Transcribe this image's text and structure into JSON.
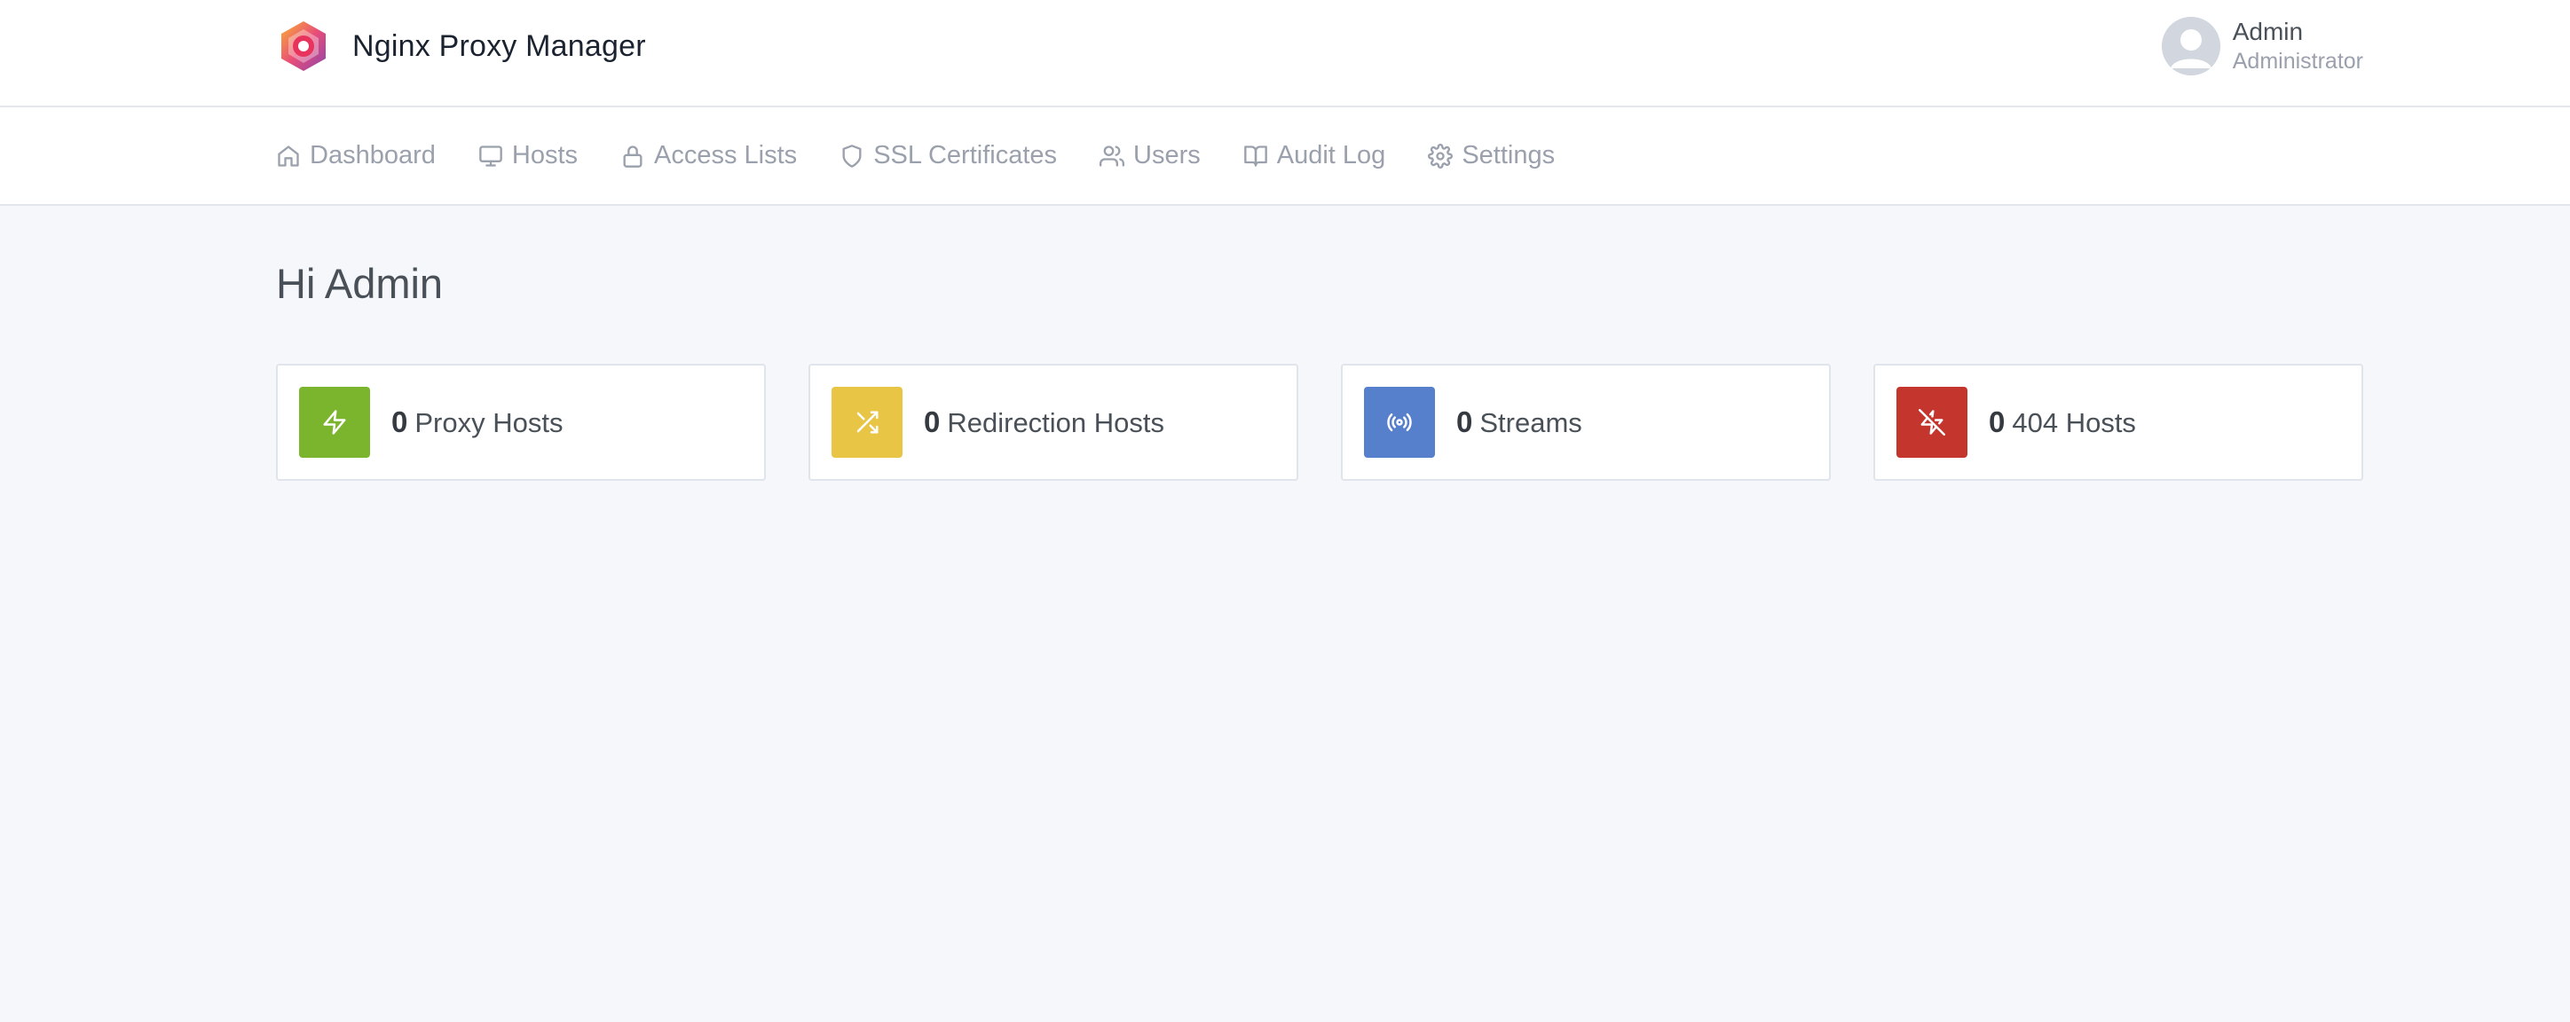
{
  "header": {
    "title": "Nginx Proxy Manager",
    "user": {
      "name": "Admin",
      "role": "Administrator"
    }
  },
  "nav": {
    "items": [
      {
        "label": "Dashboard",
        "icon": "home-icon"
      },
      {
        "label": "Hosts",
        "icon": "monitor-icon"
      },
      {
        "label": "Access Lists",
        "icon": "lock-icon"
      },
      {
        "label": "SSL Certificates",
        "icon": "shield-icon"
      },
      {
        "label": "Users",
        "icon": "users-icon"
      },
      {
        "label": "Audit Log",
        "icon": "book-icon"
      },
      {
        "label": "Settings",
        "icon": "gear-icon"
      }
    ]
  },
  "main": {
    "greeting": "Hi Admin",
    "cards": [
      {
        "count": "0",
        "label": "Proxy Hosts",
        "color": "#7bb52e",
        "icon": "zap-icon"
      },
      {
        "count": "0",
        "label": "Redirection Hosts",
        "color": "#e8c545",
        "icon": "shuffle-icon"
      },
      {
        "count": "0",
        "label": "Streams",
        "color": "#5680cc",
        "icon": "radio-icon"
      },
      {
        "count": "0",
        "label": "404 Hosts",
        "color": "#c4362d",
        "icon": "zap-off-icon"
      }
    ]
  },
  "colors": {
    "background": "#f5f7fb",
    "header_bg": "#ffffff",
    "nav_text": "#9aa0ac"
  }
}
